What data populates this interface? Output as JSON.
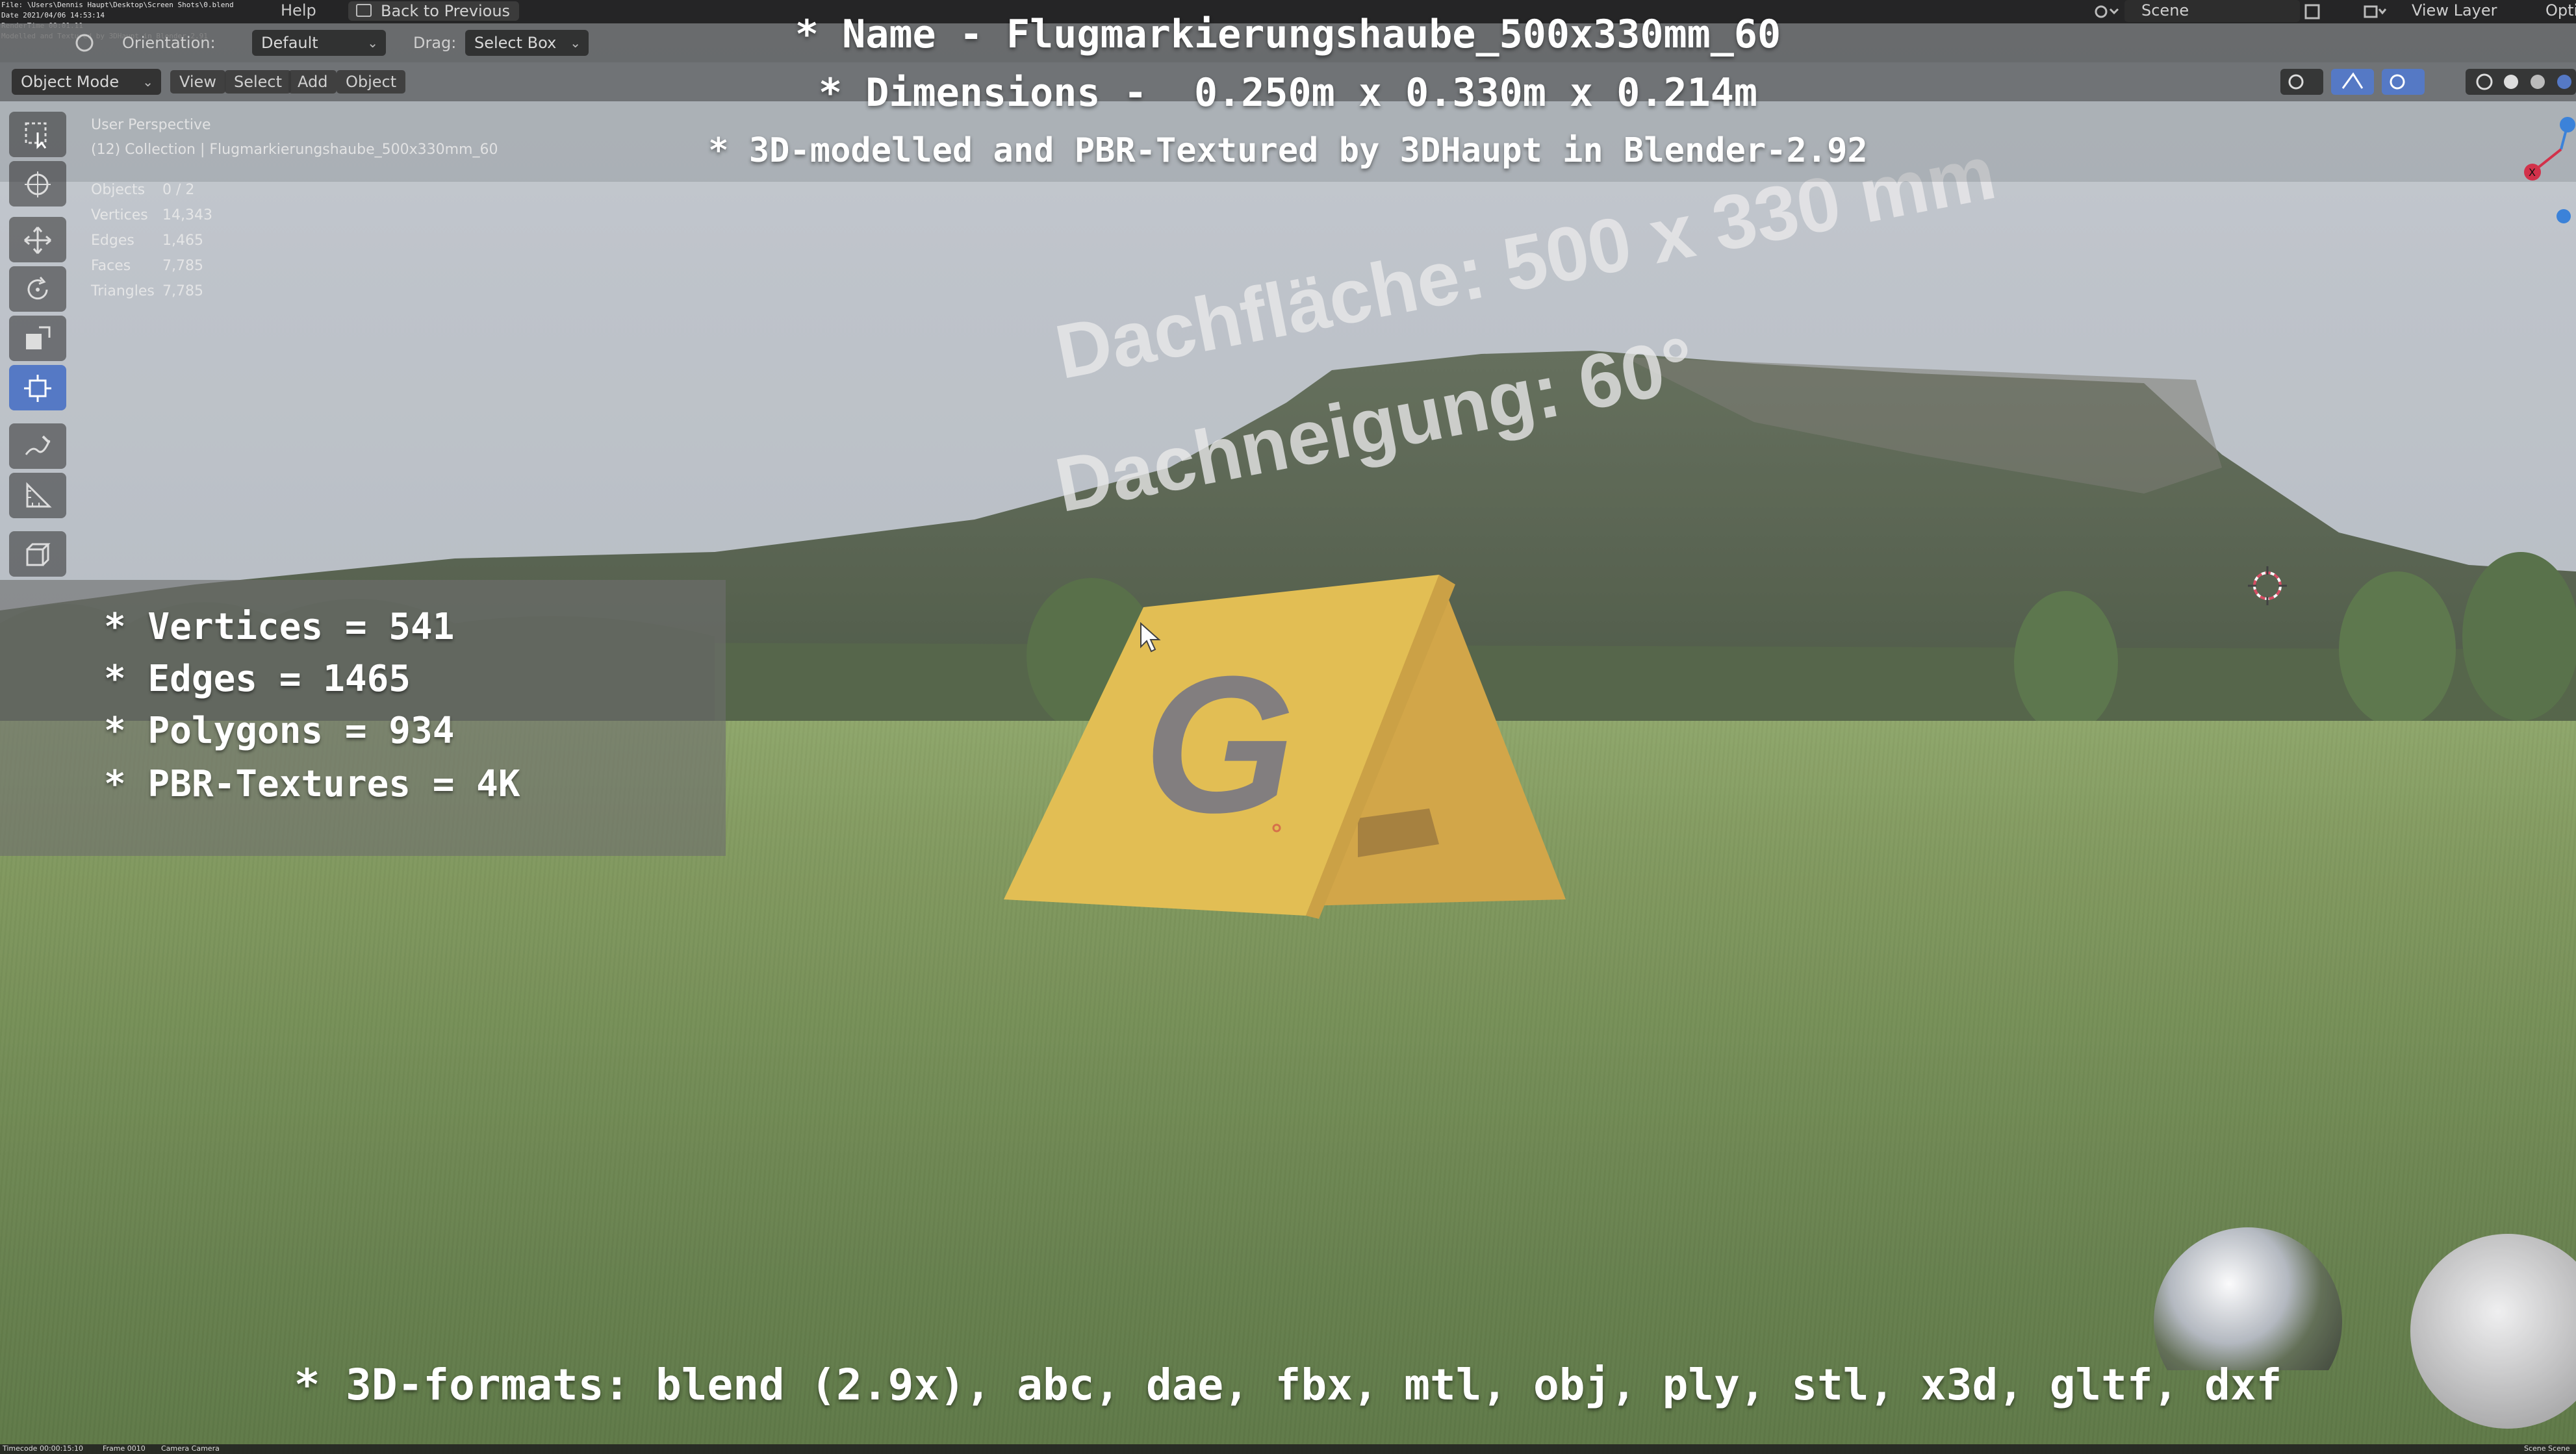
{
  "topbar": {
    "file_path_text": "File: \\Users\\Dennis Haupt\\Desktop\\Screen Shots\\0.blend\nDate 2021/04/06 14:53:14\nRenderTime 00:01.11\nModelled and Textured by 3DHaupt in Blender-2.91",
    "menu_help": "Help",
    "back_to_previous": "Back to Previous",
    "scene_label": "Scene",
    "view_layer_label": "View Layer",
    "options_label": "Opti"
  },
  "header2": {
    "orientation_label": "Orientation:",
    "orientation_value": "Default",
    "drag_label": "Drag:",
    "drag_value": "Select Box"
  },
  "header3": {
    "mode": "Object Mode",
    "view": "View",
    "select": "Select",
    "add": "Add",
    "object": "Object"
  },
  "overlay_title": {
    "line1": "* Name - Flugmarkierungshaube_500x330mm_60",
    "line2": "* Dimensions -  0.250m x 0.330m x 0.214m",
    "line3": "* 3D-modelled and PBR-Textured by 3DHaupt in Blender-2.92"
  },
  "viewport_info": {
    "perspective": "User Perspective",
    "collection": "(12) Collection | Flugmarkierungshaube_500x330mm_60",
    "stats": [
      {
        "label": "Objects",
        "value": "0 / 2"
      },
      {
        "label": "Vertices",
        "value": "14,343"
      },
      {
        "label": "Edges",
        "value": "1,465"
      },
      {
        "label": "Faces",
        "value": "7,785"
      },
      {
        "label": "Triangles",
        "value": "7,785"
      }
    ]
  },
  "stats_panel": {
    "vertices": "* Vertices = 541",
    "edges": "* Edges = 1465",
    "polygons": "* Polygons = 934",
    "textures": "* PBR-Textures = 4K"
  },
  "scene_text": {
    "roof_area": "Dachfläche:  500 x 330 mm",
    "roof_pitch": "Dachneigung:  60°",
    "sign_letter": "G"
  },
  "formats_line": "* 3D-formats: blend (2.9x), abc, dae, fbx, mtl, obj, ply, stl, x3d, gltf, dxf",
  "status_bar": {
    "timecode": "Timecode 00:00:15:10",
    "frame": "Frame 0010",
    "camera": "Camera Camera",
    "right": "Scene Scene"
  },
  "colors": {
    "active_tool": "#5579c5",
    "sign_yellow": "#e2b737",
    "axis_red": "#d2314a",
    "axis_blue": "#3b82d9"
  },
  "icons": [
    "select-box-icon",
    "cursor-icon",
    "move-icon",
    "rotate-icon",
    "scale-icon",
    "transform-icon",
    "annotate-icon",
    "measure-icon",
    "add-cube-icon"
  ]
}
